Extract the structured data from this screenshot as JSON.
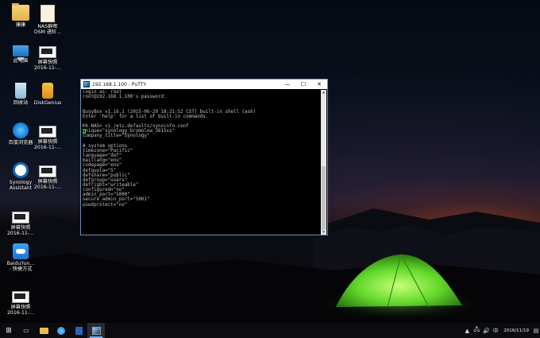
{
  "desktop": {
    "icons": [
      {
        "label": "康康",
        "glyph": "folder"
      },
      {
        "label": "NAS群晖\nDSM 进阶...",
        "glyph": "file"
      },
      {
        "label": "此电脑",
        "glyph": "pc"
      },
      {
        "label": "屏幕快照\n2016-11-...",
        "glyph": "screenshot"
      },
      {
        "label": "回收站",
        "glyph": "recycle-bin"
      },
      {
        "label": "DiskGenius",
        "glyph": "disk"
      },
      {
        "label": "百度浏览器",
        "glyph": "browser"
      },
      {
        "label": "屏幕快照\n2016-11-...",
        "glyph": "screenshot"
      },
      {
        "label": "Synology\nAssistant",
        "glyph": "synology"
      },
      {
        "label": "屏幕快照\n2016-11-...",
        "glyph": "screenshot"
      },
      {
        "label": "屏幕快照\n2016-11-...",
        "glyph": "screenshot"
      },
      {
        "label": "BaiduYun...\n- 快捷方式",
        "glyph": "baidu-cloud"
      },
      {
        "label": "屏幕快照\n2016-11-...",
        "glyph": "screenshot"
      }
    ]
  },
  "putty": {
    "title": "192.168.1.100 - PuTTY",
    "minimize": "—",
    "maximize": "☐",
    "close": "✕",
    "terminal_lines": [
      "login as: root",
      "root@192.168.1.100's password:",
      "",
      "",
      "BusyBox v1.16.1 (2015-06-29 18:21:52 CST) built-in shell (ash)",
      "Enter 'help' for a list of built-in commands.",
      "",
      "KK-NAS> vi /etc.defaults/synoinfo.conf",
      "unique=\"synology_bromolow_3615xs\"",
      "company_title=\"Synology\"",
      "",
      "# system options",
      "timezone=\"Pacific\"",
      "language=\"def\"",
      "maillang=\"enu\"",
      "codepage=\"enu\"",
      "defquota=\"5\"",
      "defshare=\"public\"",
      "defgroup=\"users\"",
      "defright=\"writeable\"",
      "configured=\"no\"",
      "admin_port=\"5000\"",
      "secure_admin_port=\"5001\"",
      "pswdprotect=\"no\""
    ],
    "cursor_line_index": 8
  },
  "taskbar": {
    "start": "⊞",
    "task_view": "▭",
    "clock_date": "2016/11/19",
    "tray": [
      "▲",
      "🖧",
      "🔊",
      "中",
      "▤"
    ]
  },
  "colors": {
    "terminal_fg": "#c0c0c0",
    "cursor": "#12c02a",
    "tent": "#7cf03c"
  }
}
